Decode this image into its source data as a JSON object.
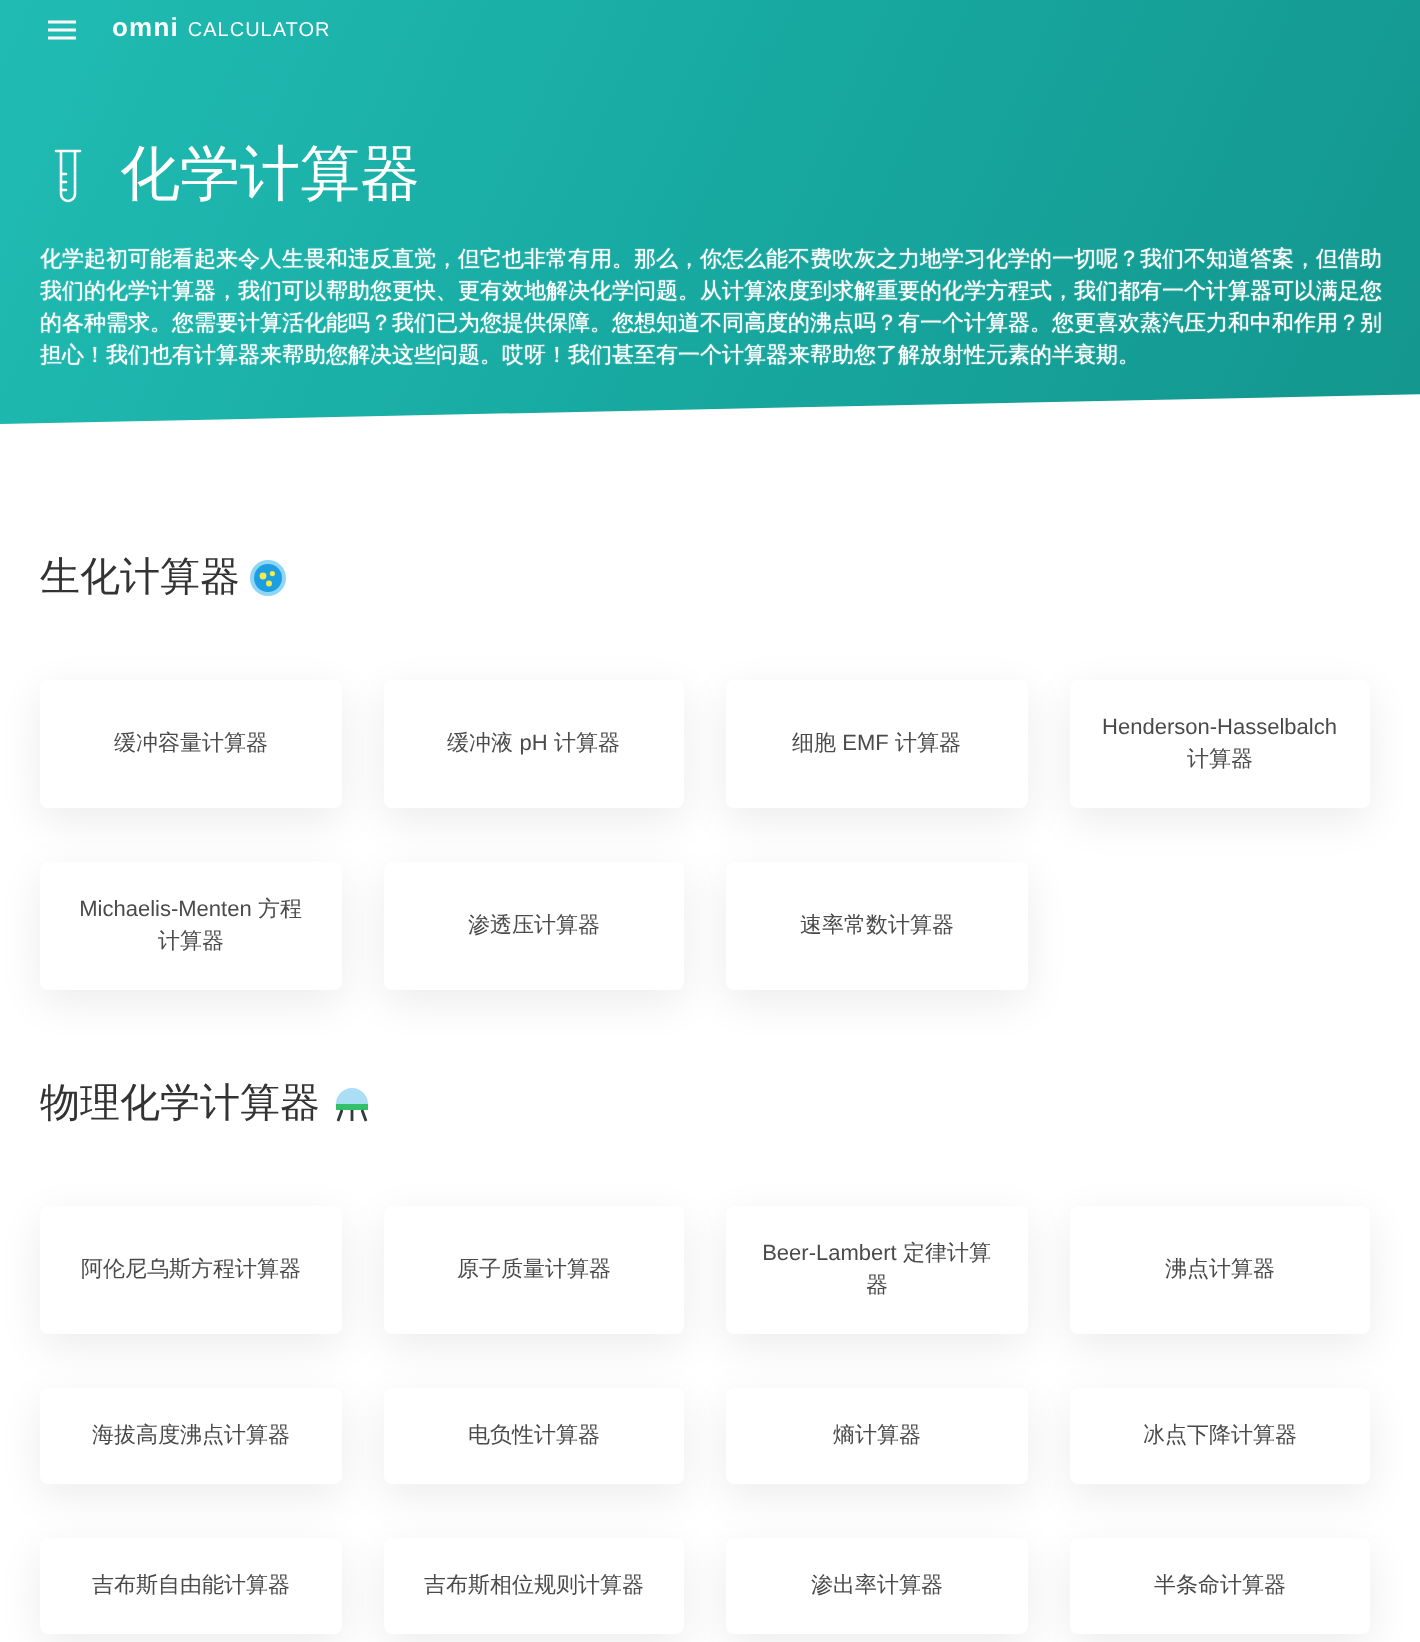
{
  "header": {
    "logo": {
      "brand": "omni",
      "product": "CALCULATOR"
    },
    "title": "化学计算器",
    "intro": "化学起初可能看起来令人生畏和违反直觉，但它也非常有用。那么，你怎么能不费吹灰之力地学习化学的一切呢？我们不知道答案，但借助我们的化学计算器，我们可以帮助您更快、更有效地解决化学问题。从计算浓度到求解重要的化学方程式，我们都有一个计算器可以满足您的各种需求。您需要计算活化能吗？我们已为您提供保障。您想知道不同高度的沸点吗？有一个计算器。您更喜欢蒸汽压力和中和作用？别担心！我们也有计算器来帮助您解决这些问题。哎呀！我们甚至有一个计算器来帮助您了解放射性元素的半衰期。"
  },
  "sections": [
    {
      "title": "生化计算器",
      "calculators": [
        "缓冲容量计算器",
        "缓冲液 pH 计算器",
        "细胞 EMF 计算器",
        "Henderson-Hasselbalch 计算器",
        "Michaelis-Menten 方程计算器",
        "渗透压计算器",
        "速率常数计算器"
      ]
    },
    {
      "title": "物理化学计算器",
      "calculators": [
        "阿伦尼乌斯方程计算器",
        "原子质量计算器",
        "Beer-Lambert 定律计算器",
        "沸点计算器",
        "海拔高度沸点计算器",
        "电负性计算器",
        "熵计算器",
        "冰点下降计算器",
        "吉布斯自由能计算器",
        "吉布斯相位规则计算器",
        "渗出率计算器",
        "半条命计算器"
      ]
    }
  ]
}
